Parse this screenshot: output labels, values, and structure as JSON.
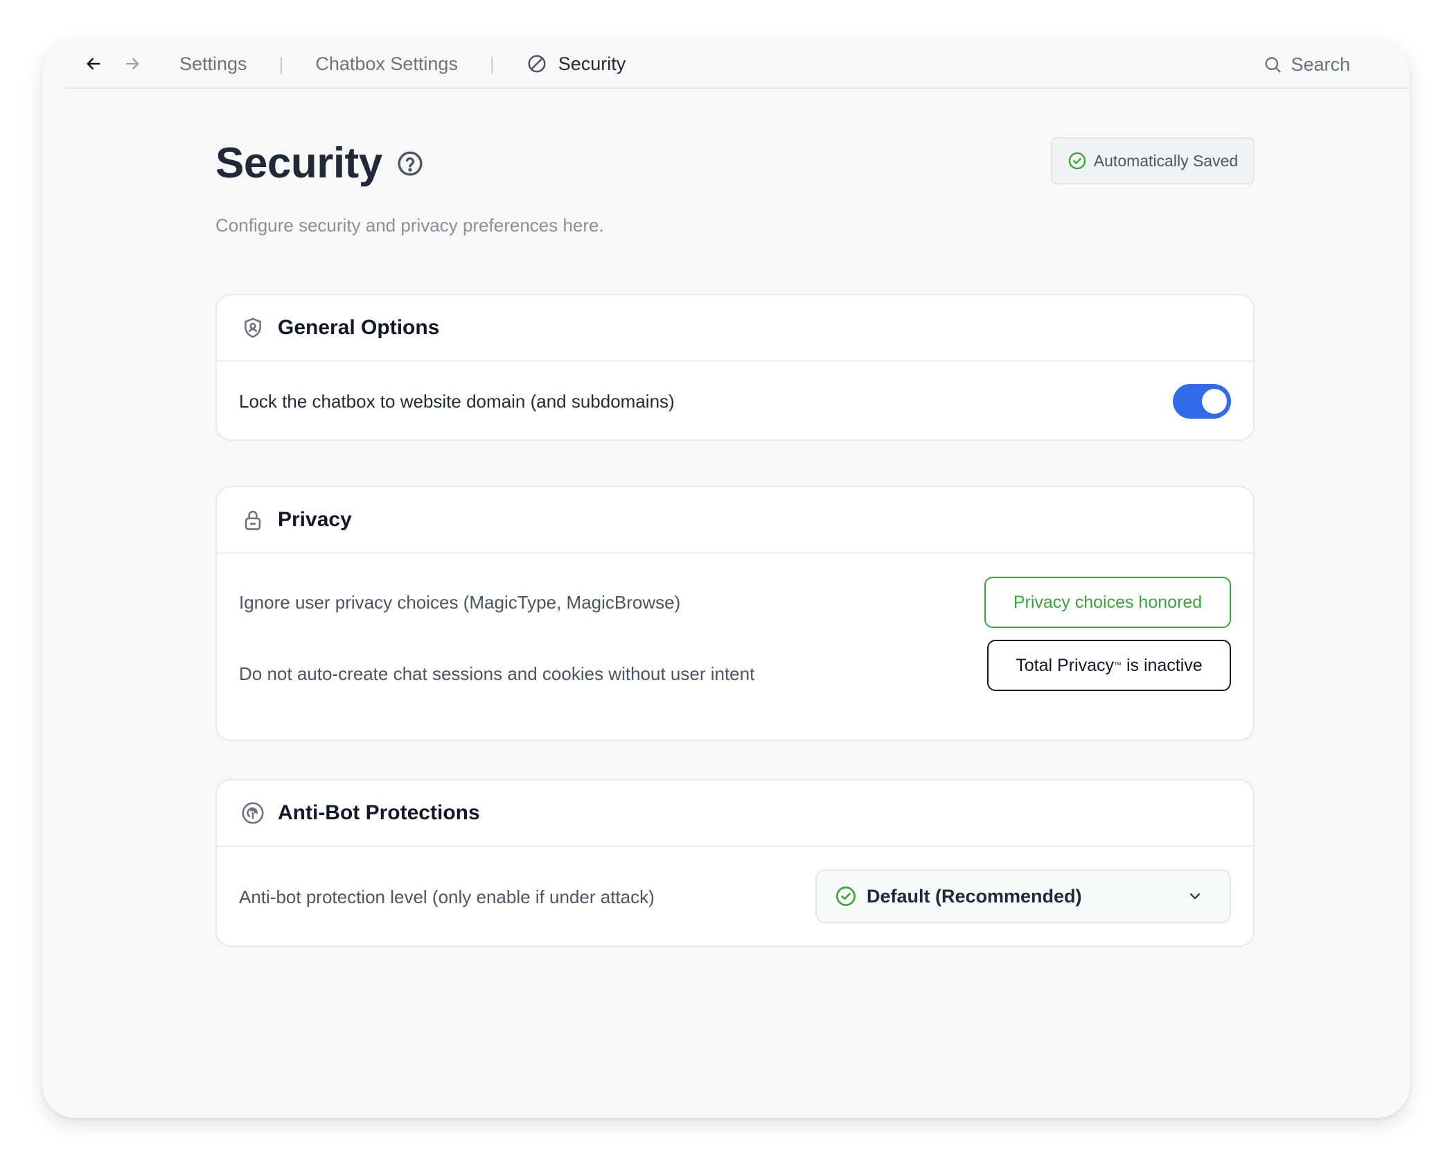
{
  "breadcrumb": {
    "items": [
      "Settings",
      "Chatbox Settings",
      "Security"
    ],
    "separator": "|"
  },
  "search": {
    "label": "Search"
  },
  "page": {
    "title": "Security",
    "subtitle": "Configure security and privacy preferences here.",
    "saved_status": "Automatically Saved"
  },
  "general": {
    "title": "General Options",
    "lock_label": "Lock the chatbox to website domain (and subdomains)",
    "lock_enabled": true
  },
  "privacy": {
    "title": "Privacy",
    "ignore_label": "Ignore user privacy choices (MagicType, MagicBrowse)",
    "ignore_button": "Privacy choices honored",
    "autocreate_label": "Do not auto-create chat sessions and cookies without user intent",
    "total_privacy_name": "Total Privacy",
    "total_privacy_tm": "™",
    "total_privacy_state": " is inactive"
  },
  "antibot": {
    "title": "Anti-Bot Protections",
    "level_label": "Anti-bot protection level (only enable if under attack)",
    "level_value": "Default (Recommended)"
  },
  "colors": {
    "accent_blue": "#2f6bea",
    "success_green": "#38a53a",
    "text_dark": "#1f2937"
  },
  "icons": {
    "back": "arrow-left-icon",
    "forward": "arrow-right-icon",
    "security_crumb": "no-entry-icon",
    "search": "search-icon",
    "help": "question-circle-icon",
    "saved": "check-circle-icon",
    "general": "shield-user-icon",
    "privacy": "lock-icon",
    "antibot": "fingerprint-circle-icon",
    "dropdown": "chevron-down-icon"
  }
}
